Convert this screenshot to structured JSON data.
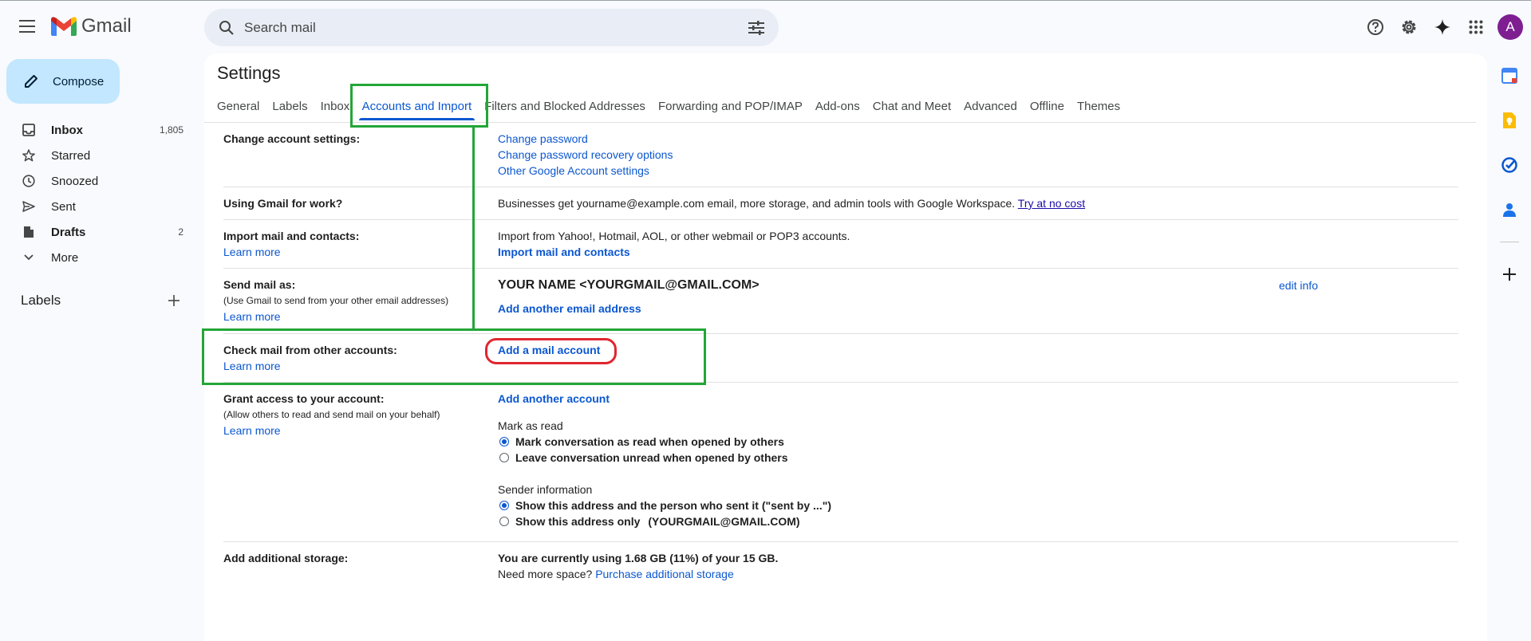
{
  "app": {
    "name": "Gmail"
  },
  "search": {
    "placeholder": "Search mail"
  },
  "account": {
    "avatar_letter": "A",
    "avatar_color": "#7e1e91"
  },
  "compose": {
    "label": "Compose"
  },
  "nav": {
    "items": [
      {
        "label": "Inbox",
        "count": "1,805",
        "bold": true
      },
      {
        "label": "Starred",
        "count": ""
      },
      {
        "label": "Snoozed",
        "count": ""
      },
      {
        "label": "Sent",
        "count": ""
      },
      {
        "label": "Drafts",
        "count": "2",
        "bold": true
      },
      {
        "label": "More",
        "count": ""
      }
    ],
    "labels_header": "Labels"
  },
  "settings": {
    "title": "Settings",
    "tabs": [
      "General",
      "Labels",
      "Inbox",
      "Accounts and Import",
      "Filters and Blocked Addresses",
      "Forwarding and POP/IMAP",
      "Add-ons",
      "Chat and Meet",
      "Advanced",
      "Offline",
      "Themes"
    ],
    "active_tab": "Accounts and Import",
    "rows": {
      "change_account": {
        "label": "Change account settings:",
        "links": [
          "Change password",
          "Change password recovery options",
          "Other Google Account settings"
        ]
      },
      "work": {
        "label": "Using Gmail for work?",
        "text": "Businesses get yourname@example.com email, more storage, and admin tools with Google Workspace.",
        "link": "Try at no cost"
      },
      "import": {
        "label": "Import mail and contacts:",
        "learn_more": "Learn more",
        "text": "Import from Yahoo!, Hotmail, AOL, or other webmail or POP3 accounts.",
        "action": "Import mail and contacts"
      },
      "send_as": {
        "label": "Send mail as:",
        "sub": "(Use Gmail to send from your other email addresses)",
        "learn_more": "Learn more",
        "name": "YOUR NAME <YOURGMAIL@GMAIL.COM>",
        "edit": "edit info",
        "action": "Add another email address"
      },
      "check_mail": {
        "label": "Check mail from other accounts:",
        "learn_more": "Learn more",
        "action": "Add a mail account"
      },
      "grant": {
        "label": "Grant access to your account:",
        "sub": "(Allow others to read and send mail on your behalf)",
        "learn_more": "Learn more",
        "action": "Add another account",
        "mark_title": "Mark as read",
        "mark_opt1": "Mark conversation as read when opened by others",
        "mark_opt2": "Leave conversation unread when opened by others",
        "sender_title": "Sender information",
        "sender_opt1": "Show this address and the person who sent it (\"sent by ...\")",
        "sender_opt2": "Show this address only",
        "sender_email": "(YOURGMAIL@GMAIL.COM)"
      },
      "storage": {
        "label": "Add additional storage:",
        "usage": "You are currently using 1.68 GB (11%) of your 15 GB.",
        "need_more": "Need more space?",
        "purchase": "Purchase additional storage"
      }
    }
  },
  "colors": {
    "accent": "#0b57d0",
    "annotation_green": "#23a638",
    "annotation_red": "#e0262f"
  }
}
